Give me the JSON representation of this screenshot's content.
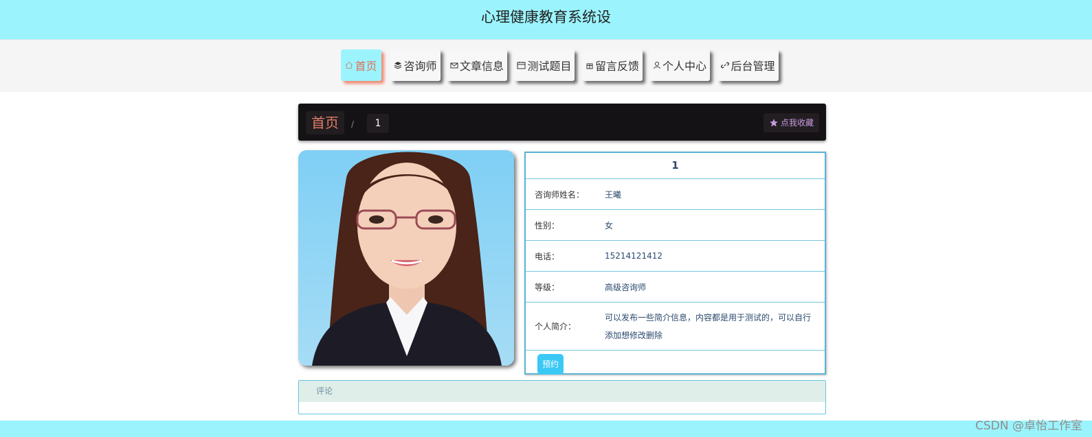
{
  "header": {
    "title": "心理健康教育系统设"
  },
  "nav": [
    {
      "label": "首页",
      "icon": "home-icon",
      "active": true
    },
    {
      "label": "咨询师",
      "icon": "layers-icon",
      "active": false
    },
    {
      "label": "文章信息",
      "icon": "mail-icon",
      "active": false
    },
    {
      "label": "测试题目",
      "icon": "calendar-icon",
      "active": false
    },
    {
      "label": "留言反馈",
      "icon": "gift-icon",
      "active": false
    },
    {
      "label": "个人中心",
      "icon": "user-icon",
      "active": false
    },
    {
      "label": "后台管理",
      "icon": "link-icon",
      "active": false
    }
  ],
  "breadcrumb": {
    "home": "首页",
    "separator": "/",
    "current": "1"
  },
  "favorite": {
    "label": "点我收藏",
    "icon": "star-icon"
  },
  "detail": {
    "title": "1",
    "rows": [
      {
        "label": "咨询师姓名：",
        "value": "王曦"
      },
      {
        "label": "性别：",
        "value": "女"
      },
      {
        "label": "电话：",
        "value": "15214121412"
      },
      {
        "label": "等级：",
        "value": "高级咨询师"
      },
      {
        "label": "个人简介：",
        "value": "可以发布一些简介信息，内容都是用于测试的，可以自行添加想修改删除"
      }
    ],
    "book_label": "预约"
  },
  "comment": {
    "header": "评论"
  },
  "watermark": "CSDN @卓怡工作室",
  "colors": {
    "header_bg": "#9bf4fd",
    "nav_active_text": "#e0705a",
    "crumb_bg": "#141214",
    "book_btn": "#3ac8f5",
    "info_border": "#5bb3d6"
  }
}
